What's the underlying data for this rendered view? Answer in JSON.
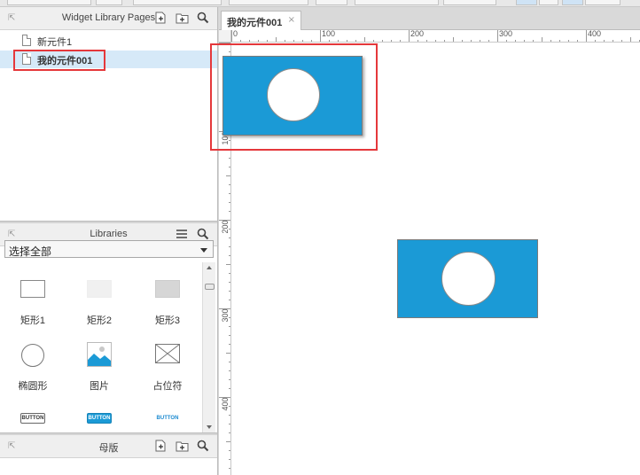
{
  "widget_pages_panel": {
    "title": "Widget Library Pages",
    "pages": [
      {
        "label": "新元件1",
        "selected": false
      },
      {
        "label": "我的元件001",
        "selected": true
      }
    ],
    "icons": [
      "add-page-icon",
      "add-folder-icon",
      "search-icon"
    ]
  },
  "libraries_panel": {
    "title": "Libraries",
    "filter_value": "选择全部",
    "items": [
      {
        "label": "矩形1",
        "icon": "rectangle-outline-icon"
      },
      {
        "label": "矩形2",
        "icon": "rectangle-light-icon"
      },
      {
        "label": "矩形3",
        "icon": "rectangle-gray-icon"
      },
      {
        "label": "椭圆形",
        "icon": "ellipse-icon"
      },
      {
        "label": "图片",
        "icon": "image-icon"
      },
      {
        "label": "占位符",
        "icon": "placeholder-icon"
      }
    ],
    "buttons": [
      {
        "text": "BUTTON",
        "style": "outline"
      },
      {
        "text": "BUTTON",
        "style": "primary"
      },
      {
        "text": "BUTTON",
        "style": "link"
      }
    ]
  },
  "masters_panel": {
    "title": "母版"
  },
  "canvas": {
    "tab_label": "我的元件001",
    "tab_close": "×",
    "h_ruler_labels": [
      "0",
      "100",
      "200",
      "300",
      "400"
    ],
    "v_ruler_labels": [
      "100",
      "200",
      "300",
      "400"
    ]
  },
  "colors": {
    "widget_fill": "#1b9ad6",
    "highlight": "#e5383b",
    "selected_row": "#d6e9f8"
  }
}
